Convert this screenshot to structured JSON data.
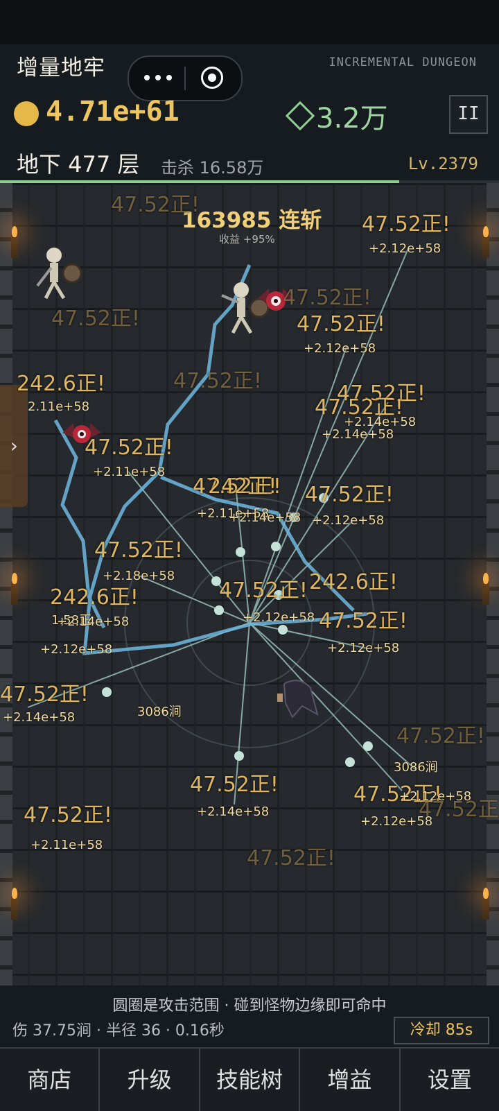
{
  "header": {
    "title": "增量地牢",
    "subtitle": "INCREMENTAL DUNGEON",
    "gold": "4.71e+61",
    "gems": "3.2万",
    "pause_label": "II",
    "floor": "地下 477 层",
    "kills": "击杀 16.58万",
    "level": "Lv.2379",
    "floor_progress": 0.8
  },
  "combat": {
    "combo": "163985 连斩",
    "combo_bonus": "收益 +95%",
    "floats": [
      {
        "t": "47.52正!",
        "type": "big dim"
      },
      {
        "t": "47.52正!",
        "type": "big"
      },
      {
        "t": "+2.12e+58",
        "type": "small"
      },
      {
        "t": "47.52正!",
        "type": "big dim"
      },
      {
        "t": "47.52正!",
        "type": "big dim"
      },
      {
        "t": "47.52正!",
        "type": "big"
      },
      {
        "t": "+2.12e+58",
        "type": "small"
      },
      {
        "t": "242.6正!",
        "type": "big"
      },
      {
        "t": "2.11e+58",
        "type": "small"
      },
      {
        "t": "47.52正!",
        "type": "big dim"
      },
      {
        "t": "47.52正!",
        "type": "big"
      },
      {
        "t": "47.52正!",
        "type": "big"
      },
      {
        "t": "+2.14e+58",
        "type": "small"
      },
      {
        "t": "+2.14e+58",
        "type": "small"
      },
      {
        "t": "47.52正!",
        "type": "big"
      },
      {
        "t": "+2.11e+58",
        "type": "small"
      },
      {
        "t": "47.52正!",
        "type": "big"
      },
      {
        "t": "242正!",
        "type": "big"
      },
      {
        "t": "+2.11e+58",
        "type": "small"
      },
      {
        "t": "+2.14e+58",
        "type": "small"
      },
      {
        "t": "47.52正!",
        "type": "big"
      },
      {
        "t": "+2.12e+58",
        "type": "small"
      },
      {
        "t": "47.52正!",
        "type": "big"
      },
      {
        "t": "+2.18e+58",
        "type": "small"
      },
      {
        "t": "242.6正!",
        "type": "big"
      },
      {
        "t": "47.52正!",
        "type": "big"
      },
      {
        "t": "242.6正!",
        "type": "big"
      },
      {
        "t": "1.58正",
        "type": "small"
      },
      {
        "t": "+2.14e+58",
        "type": "small"
      },
      {
        "t": "47.52正!",
        "type": "big"
      },
      {
        "t": "+2.12e+58",
        "type": "small"
      },
      {
        "t": "+2.12e+58",
        "type": "small"
      },
      {
        "t": "+2.12e+58",
        "type": "small"
      },
      {
        "t": "47.52正!",
        "type": "big"
      },
      {
        "t": "+2.14e+58",
        "type": "small"
      },
      {
        "t": "3086涧",
        "type": "small"
      },
      {
        "t": "47.52正!",
        "type": "big dim"
      },
      {
        "t": "3086涧",
        "type": "small"
      },
      {
        "t": "47.52正!",
        "type": "big"
      },
      {
        "t": "47.52正!",
        "type": "big"
      },
      {
        "t": "+2.12e+58",
        "type": "small"
      },
      {
        "t": "47.52正!",
        "type": "big dim"
      },
      {
        "t": "+2.12e+58",
        "type": "small"
      },
      {
        "t": "+2.14e+58",
        "type": "small"
      },
      {
        "t": "47.52正!",
        "type": "big"
      },
      {
        "t": "+2.11e+58",
        "type": "small"
      },
      {
        "t": "47.52正!",
        "type": "big dim"
      }
    ]
  },
  "bottom": {
    "hint": "圆圈是攻击范围 · 碰到怪物边缘即可命中",
    "stats": "伤 37.75涧 · 半径 36 · 0.16秒",
    "cooldown": "冷却 85s"
  },
  "nav": [
    "商店",
    "升级",
    "技能树",
    "增益",
    "设置"
  ]
}
